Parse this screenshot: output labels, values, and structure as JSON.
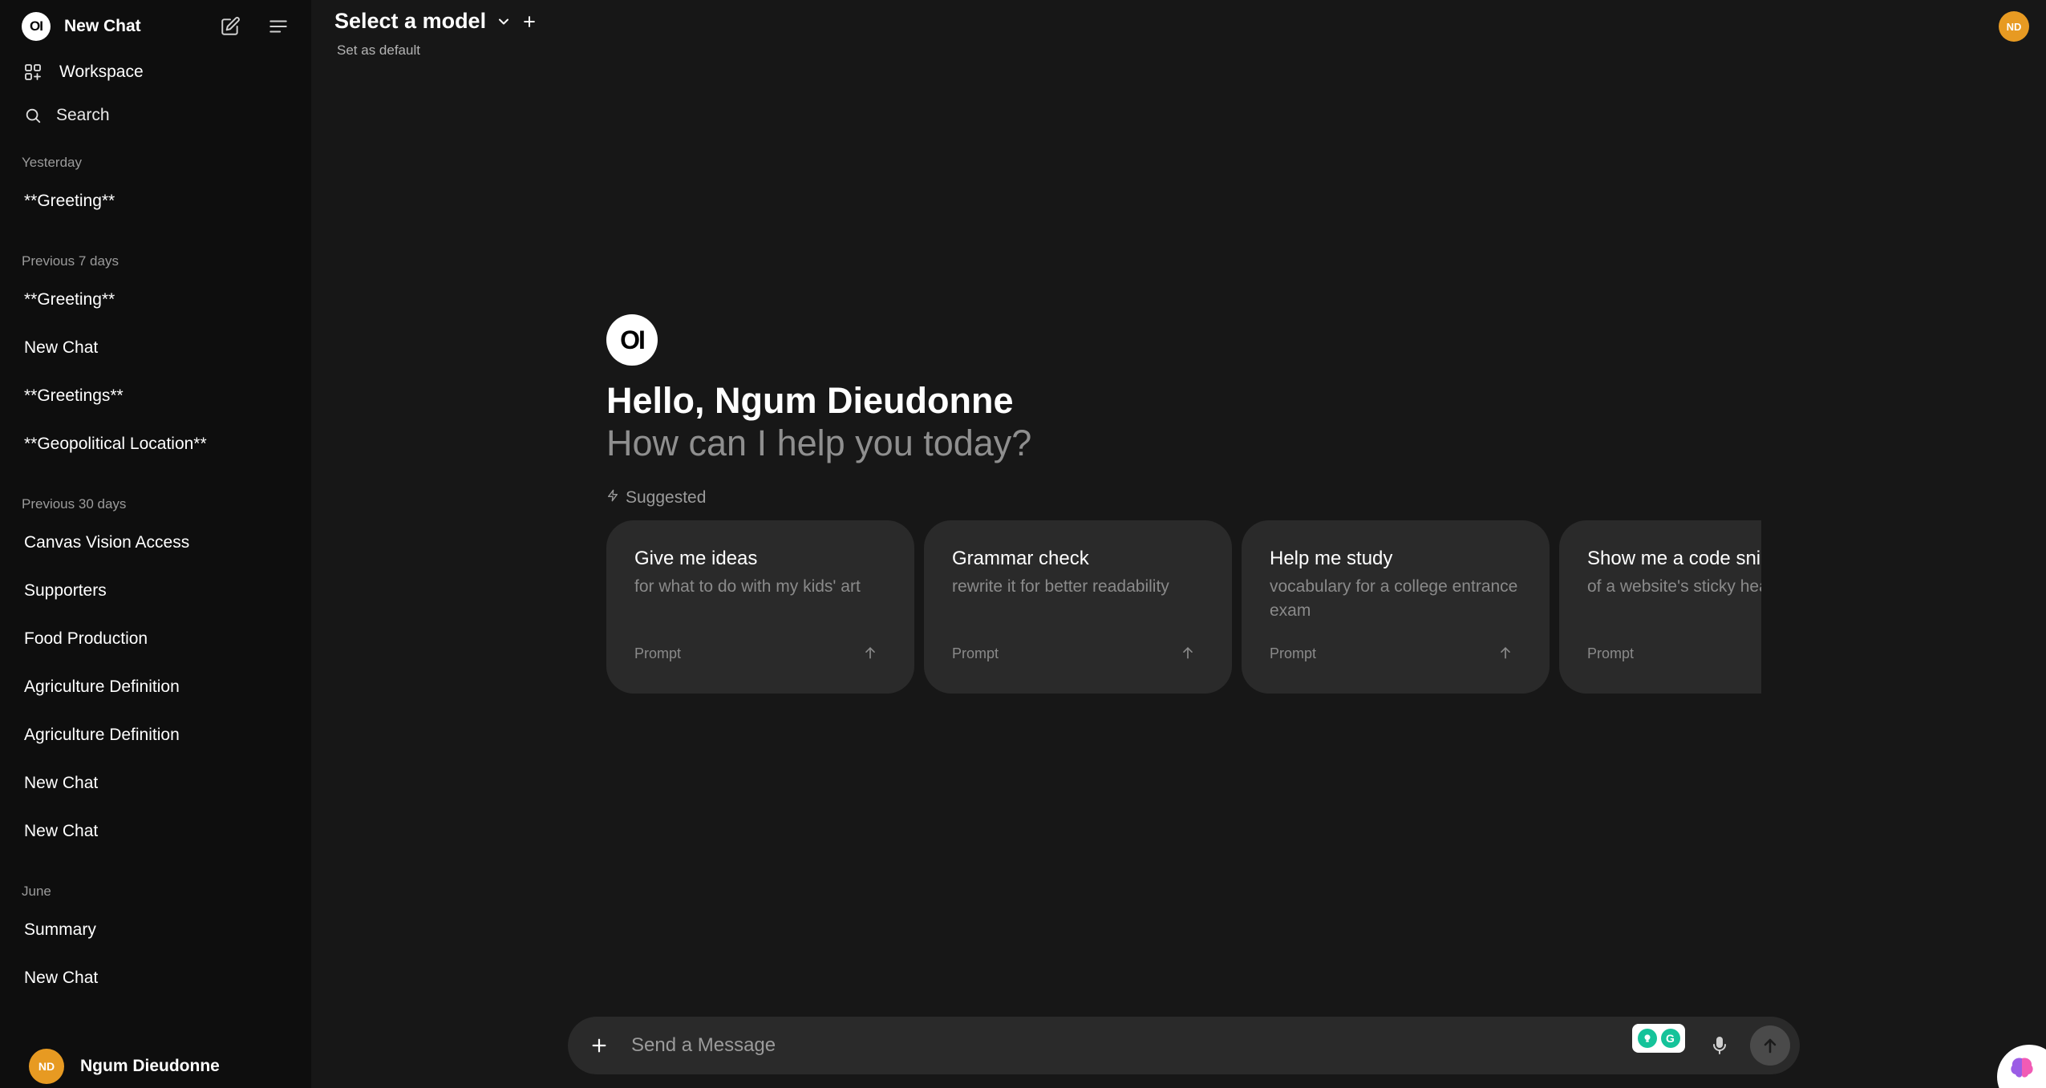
{
  "sidebar": {
    "logo_text": "OI",
    "new_chat": "New Chat",
    "workspace": "Workspace",
    "search": "Search",
    "groups": [
      {
        "label": "Yesterday",
        "items": [
          "**Greeting**"
        ]
      },
      {
        "label": "Previous 7 days",
        "items": [
          "**Greeting**",
          "New Chat",
          "**Greetings**",
          "**Geopolitical Location**"
        ]
      },
      {
        "label": "Previous 30 days",
        "items": [
          "Canvas Vision Access",
          "Supporters",
          "Food Production",
          "Agriculture Definition",
          "Agriculture Definition",
          "New Chat",
          "New Chat"
        ]
      },
      {
        "label": "June",
        "items": [
          "Summary",
          "New Chat"
        ]
      }
    ],
    "user": {
      "initials": "ND",
      "name": "Ngum Dieudonne"
    }
  },
  "header": {
    "model_title": "Select a model",
    "set_default": "Set as default",
    "user_initials": "ND"
  },
  "main": {
    "logo_text": "OI",
    "greeting": "Hello, Ngum Dieudonne",
    "subtitle": "How can I help you today?",
    "suggested_label": "Suggested",
    "cards": [
      {
        "title": "Give me ideas",
        "subtitle": "for what to do with my kids' art",
        "tag": "Prompt"
      },
      {
        "title": "Grammar check",
        "subtitle": "rewrite it for better readability",
        "tag": "Prompt"
      },
      {
        "title": "Help me study",
        "subtitle": "vocabulary for a college entrance exam",
        "tag": "Prompt"
      },
      {
        "title": "Show me a code snippet",
        "subtitle": "of a website's sticky header",
        "tag": "Prompt"
      }
    ]
  },
  "composer": {
    "placeholder": "Send a Message",
    "extension_letter": "G"
  },
  "colors": {
    "background": "#171717",
    "sidebar": "#0e0e0e",
    "card": "#2a2a2a",
    "avatar": "#e79a22",
    "grammarly": "#15c39a"
  }
}
